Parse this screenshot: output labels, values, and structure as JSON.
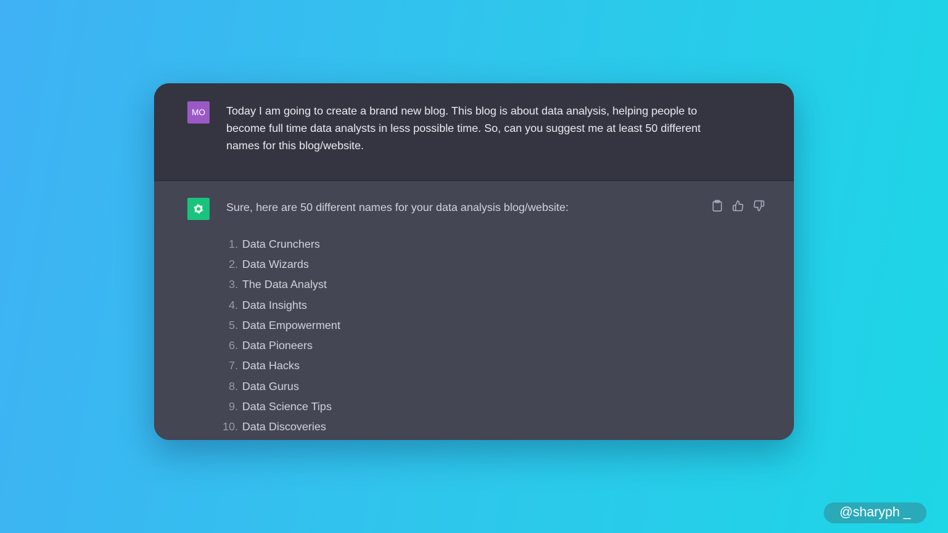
{
  "conversation": {
    "user": {
      "avatar_initials": "MO",
      "message": "Today I am going to create a brand new blog. This blog is about data analysis, helping people to become full time data analysts in less possible time. So, can you suggest me at least 50 different names for this blog/website."
    },
    "assistant": {
      "avatar_icon": "openai-logo-icon",
      "intro": "Sure, here are 50 different names for your data analysis blog/website:",
      "actions": [
        "clipboard-icon",
        "thumbs-up-icon",
        "thumbs-down-icon"
      ],
      "names": [
        {
          "num": "1.",
          "text": "Data Crunchers"
        },
        {
          "num": "2.",
          "text": "Data Wizards"
        },
        {
          "num": "3.",
          "text": "The Data Analyst"
        },
        {
          "num": "4.",
          "text": "Data Insights"
        },
        {
          "num": "5.",
          "text": "Data Empowerment"
        },
        {
          "num": "6.",
          "text": "Data Pioneers"
        },
        {
          "num": "7.",
          "text": "Data Hacks"
        },
        {
          "num": "8.",
          "text": "Data Gurus"
        },
        {
          "num": "9.",
          "text": "Data Science Tips"
        },
        {
          "num": "10.",
          "text": "Data Discoveries"
        }
      ]
    }
  },
  "watermark": "@sharyph _",
  "colors": {
    "user_bg": "#343541",
    "assistant_bg": "#444654",
    "user_avatar": "#9b59c6",
    "bot_avatar": "#19c37d"
  }
}
